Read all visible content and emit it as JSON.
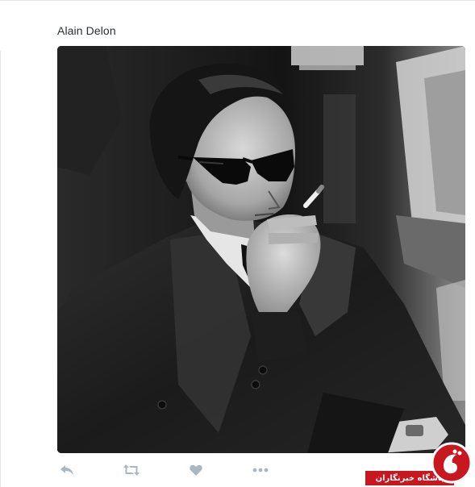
{
  "tweet": {
    "text": "Alain Delon"
  },
  "actions": {
    "reply_icon": "reply-icon",
    "retweet_icon": "retweet-icon",
    "like_icon": "heart-icon",
    "more_icon": "more-dots-icon",
    "icon_color": "#aab8c2"
  },
  "watermark": {
    "label": "باشگاه خبرنگاران",
    "color": "#c8171e"
  }
}
